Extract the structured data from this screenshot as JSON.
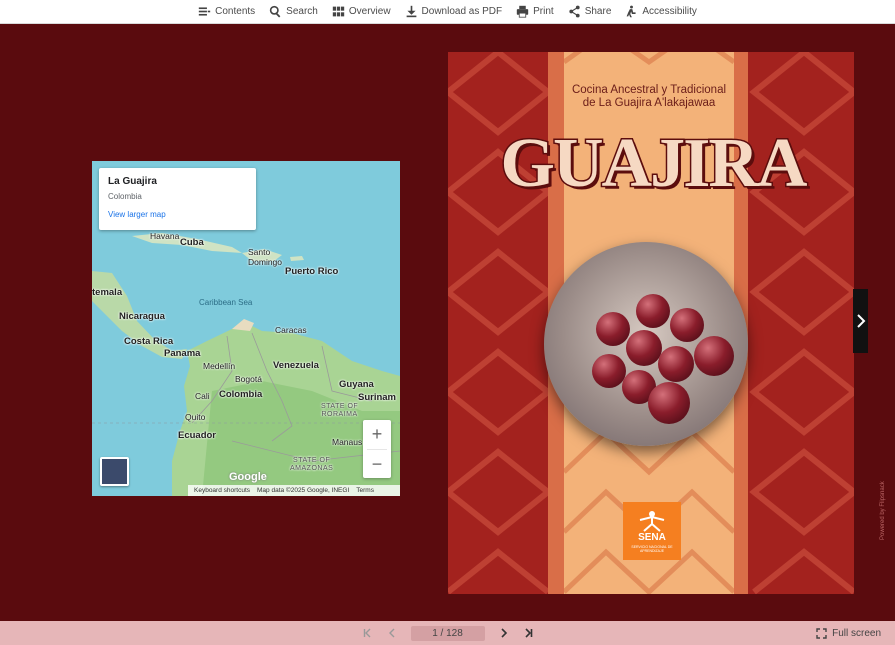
{
  "toolbar": {
    "contents": "Contents",
    "search": "Search",
    "overview": "Overview",
    "download": "Download as PDF",
    "print": "Print",
    "share": "Share",
    "accessibility": "Accessibility"
  },
  "map": {
    "card_title": "La Guajira",
    "card_subtitle": "Colombia",
    "card_link": "View larger map",
    "labels": {
      "havana": "Havana",
      "cuba": "Cuba",
      "santo_domingo": "Santo\nDomingo",
      "puerto_rico": "Puerto Rico",
      "guatemala": "temala",
      "caribbean_sea": "Caribbean Sea",
      "nicaragua": "Nicaragua",
      "caracas": "Caracas",
      "costa_rica": "Costa Rica",
      "panama": "Panama",
      "medellin": "Medellín",
      "venezuela": "Venezuela",
      "bogota": "Bogotá",
      "guyana": "Guyana",
      "cali": "Cali",
      "colombia": "Colombia",
      "suriname": "Surinam",
      "state_roraima": "STATE OF\nRORAIMA",
      "quito": "Quito",
      "ecuador": "Ecuador",
      "manaus": "Manaus",
      "state_amazonas": "STATE OF\nAMAZONAS"
    },
    "zoom_in": "+",
    "zoom_out": "−",
    "google": "Google",
    "shortcuts": "Keyboard shortcuts",
    "mapdata": "Map data ©2025 Google, INEGI",
    "terms": "Terms"
  },
  "cover": {
    "subtitle_line1": "Cocina Ancestral y Tradicional",
    "subtitle_line2": "de La Guajira A'lakajawaa",
    "title": "GUAJIRA",
    "logo_name": "SENA",
    "logo_small": "SERVICIO NACIONAL DE APRENDIZAJE",
    "vertical_text": "Powered by Flipsnack"
  },
  "pager": {
    "page_indicator": "1 / 128",
    "fullscreen": "Full screen"
  },
  "colors": {
    "background": "#5a0b0e",
    "cover_red": "#a3221e",
    "band_orange": "#f3b279",
    "logo_orange": "#f57f20",
    "bottom_bar": "#e6b6b8"
  }
}
